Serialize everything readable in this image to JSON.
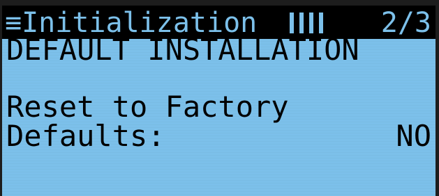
{
  "screen": {
    "menu_label": "Initialization",
    "page_indicator": "2/3",
    "subtitle": "DEFAULT INSTALLATION",
    "setting_line1": "Reset to Factory",
    "setting_line2": "Defaults:",
    "setting_value": "NO"
  },
  "colors": {
    "screen_background": "#7cc0ea",
    "title_bar": "#000000",
    "frame": "#1d1d1d"
  }
}
